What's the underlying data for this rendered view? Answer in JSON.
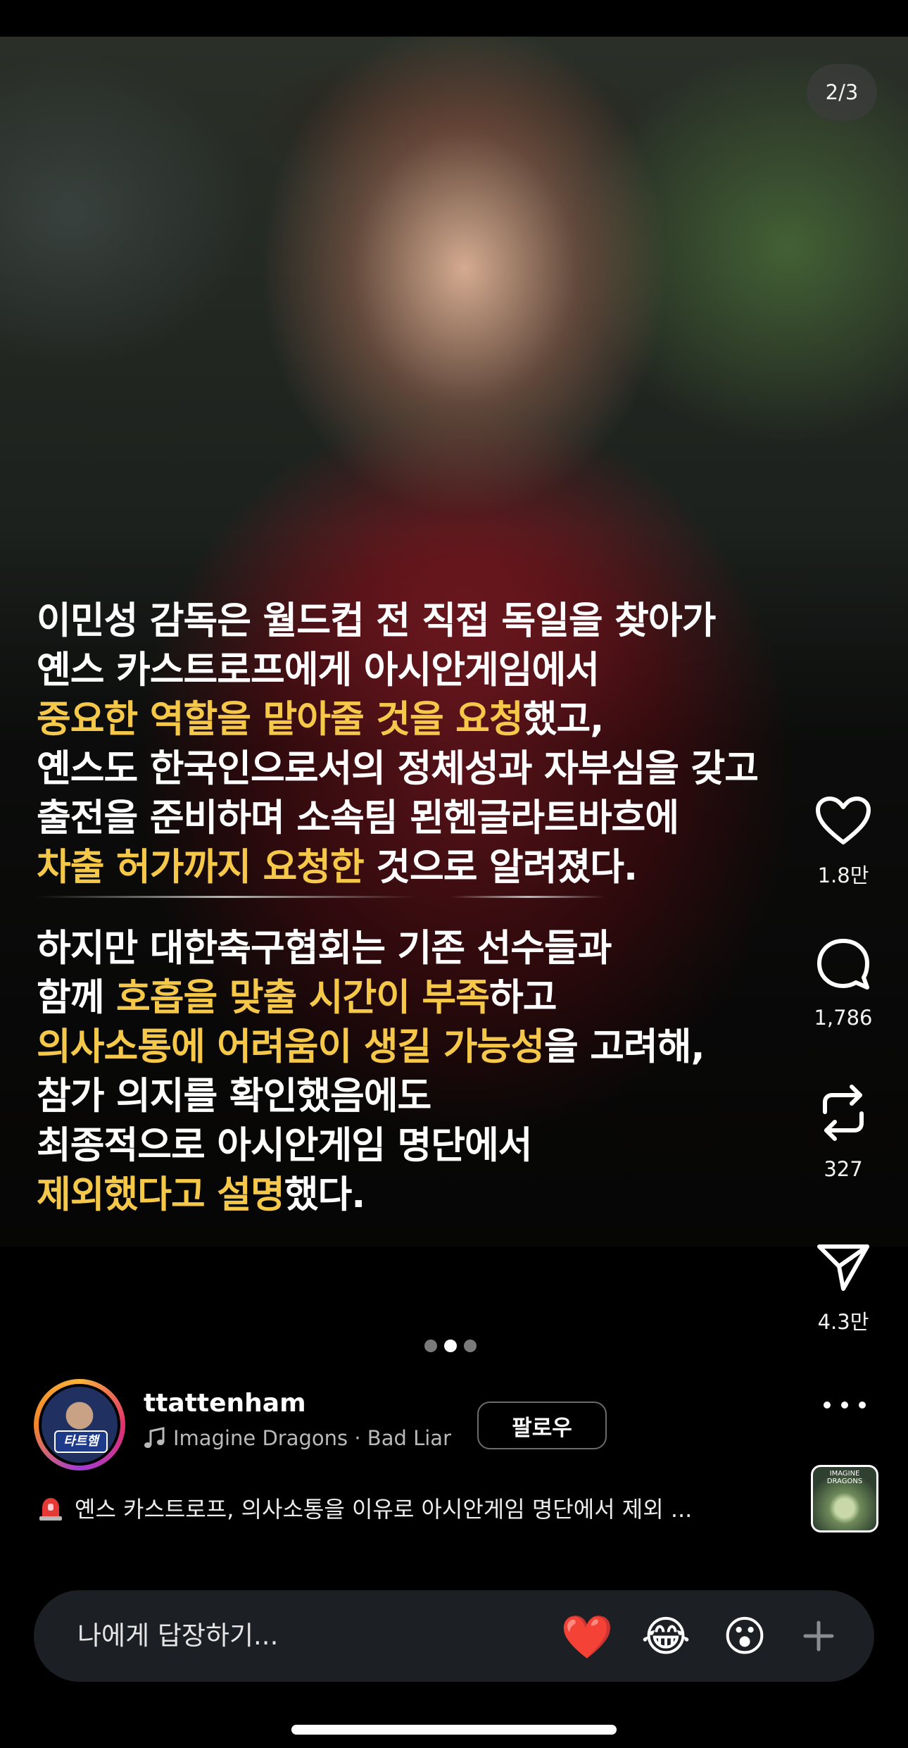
{
  "post": {
    "page_counter": "2/3",
    "caption_lines": [
      [
        {
          "t": "이민성 감독은 월드컵 전 직접 독일을 찾아가",
          "hl": false
        }
      ],
      [
        {
          "t": "옌스 카스트로프에게 아시안게임에서",
          "hl": false
        }
      ],
      [
        {
          "t": "중요한 역할을 맡아줄 것을 요청",
          "hl": true
        },
        {
          "t": "했고,",
          "hl": false
        }
      ],
      [
        {
          "t": "옌스도 한국인으로서의 정체성과 자부심을 갖고",
          "hl": false
        }
      ],
      [
        {
          "t": "출전을 준비하며 소속팀 묀헨글라트바흐에",
          "hl": false
        }
      ],
      [
        {
          "t": "차출 허가까지 요청한",
          "hl": true
        },
        {
          "t": " 것으로 알려졌다.",
          "hl": false
        }
      ],
      [
        {
          "t": "하지만 대한축구협회는 기존 선수들과",
          "hl": false
        }
      ],
      [
        {
          "t": "함께 ",
          "hl": false
        },
        {
          "t": "호흡을 맞출 시간이 부족",
          "hl": true
        },
        {
          "t": "하고",
          "hl": false
        }
      ],
      [
        {
          "t": "의사소통에 어려움이 생길 가능성",
          "hl": true
        },
        {
          "t": "을 고려해,",
          "hl": false
        }
      ],
      [
        {
          "t": "참가 의지를 확인했음에도",
          "hl": false
        }
      ],
      [
        {
          "t": "최종적으로 아시안게임 명단에서",
          "hl": false
        }
      ],
      [
        {
          "t": "제외했다고 설명",
          "hl": true
        },
        {
          "t": "했다.",
          "hl": false
        }
      ]
    ],
    "carousel": {
      "total": 3,
      "active_index": 1
    }
  },
  "actions": {
    "likes": "1.8만",
    "comments": "1,786",
    "reposts": "327",
    "shares": "4.3만"
  },
  "author": {
    "username": "ttattenham",
    "avatar_badge": "타트햄",
    "music": "Imagine Dragons · Bad Liar",
    "follow_label": "팔로우"
  },
  "album": {
    "label": "IMAGINE DRAGONS"
  },
  "description": {
    "icon": "siren-icon",
    "text": "옌스 카스트로프, 의사소통을 이유로 아시안게임 명단에서 제외 ..."
  },
  "reply": {
    "placeholder": "나에게 답장하기...",
    "quick_reactions": [
      "❤️",
      "😂",
      "😮"
    ]
  },
  "colors": {
    "highlight": "#f5c84a",
    "background": "#000000",
    "reply_bar": "#1c1f23"
  }
}
